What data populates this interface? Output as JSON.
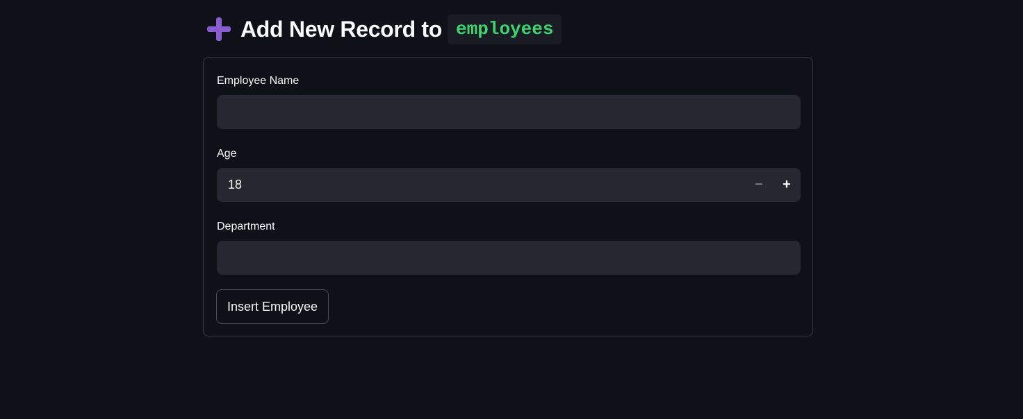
{
  "header": {
    "icon": "plus-icon",
    "icon_color": "#8a5cd1",
    "title": "Add New Record to",
    "table_name": "employees",
    "table_name_color": "#3dd56d"
  },
  "form": {
    "fields": [
      {
        "label": "Employee Name",
        "value": "",
        "placeholder": ""
      },
      {
        "label": "Age",
        "value": "18"
      },
      {
        "label": "Department",
        "value": "",
        "placeholder": ""
      }
    ],
    "stepper": {
      "minus": "−",
      "plus": "+"
    },
    "submit_label": "Insert Employee"
  },
  "colors": {
    "background": "#0e1117",
    "input_background": "#262730",
    "border": "#363942"
  }
}
